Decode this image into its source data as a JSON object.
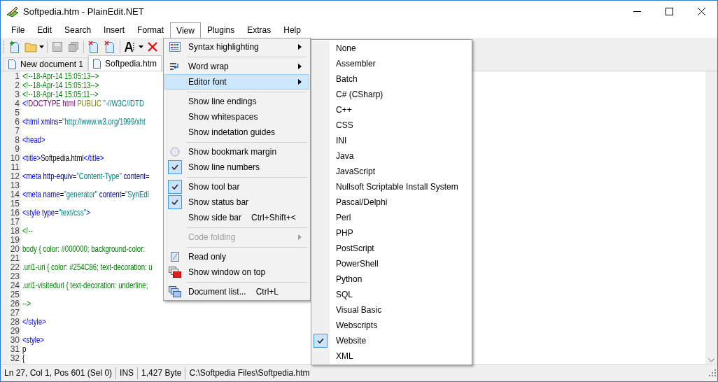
{
  "window": {
    "title": "Softpedia.htm - PlainEdit.NET"
  },
  "menu_bar": [
    {
      "label": "File",
      "selected": false
    },
    {
      "label": "Edit",
      "selected": false
    },
    {
      "label": "Search",
      "selected": false
    },
    {
      "label": "Insert",
      "selected": false
    },
    {
      "label": "Format",
      "selected": false
    },
    {
      "label": "View",
      "selected": true
    },
    {
      "label": "Plugins",
      "selected": false
    },
    {
      "label": "Extras",
      "selected": false
    },
    {
      "label": "Help",
      "selected": false
    }
  ],
  "tabs": [
    {
      "label": "New document 1",
      "selected": false
    },
    {
      "label": "Softpedia.htm",
      "selected": true
    }
  ],
  "editor": {
    "lines": [
      {
        "number": "1",
        "tokens": [
          {
            "kind": "comment",
            "text": "<!--18-Apr-14 15:05:13-->"
          }
        ]
      },
      {
        "number": "2",
        "tokens": [
          {
            "kind": "comment",
            "text": "<!--18-Apr-14 15:05:13-->"
          }
        ]
      },
      {
        "number": "3",
        "tokens": [
          {
            "kind": "comment",
            "text": "<!--18-Apr-14 15:05:11-->"
          }
        ]
      },
      {
        "number": "4",
        "tokens": [
          {
            "kind": "tag",
            "text": "<!"
          },
          {
            "kind": "doctype",
            "text": "DOCTYPE html "
          },
          {
            "kind": "keyword",
            "text": "PUBLIC "
          },
          {
            "kind": "value",
            "text": "\"-//W3C//DTD"
          }
        ]
      },
      {
        "number": "5"
      },
      {
        "number": "6",
        "tokens": [
          {
            "kind": "tag",
            "text": "<html"
          },
          {
            "kind": "attr",
            "text": " xmlns"
          },
          {
            "kind": "text",
            "text": "="
          },
          {
            "kind": "value",
            "text": "\"http://www.w3.org/1999/xht"
          }
        ]
      },
      {
        "number": "7"
      },
      {
        "number": "8",
        "tokens": [
          {
            "kind": "tag",
            "text": "<head>"
          }
        ]
      },
      {
        "number": "9"
      },
      {
        "number": "10",
        "tokens": [
          {
            "kind": "tag",
            "text": "<title>"
          },
          {
            "kind": "text",
            "text": "Softpedia.html"
          },
          {
            "kind": "tag",
            "text": "</title>"
          }
        ]
      },
      {
        "number": "11"
      },
      {
        "number": "12",
        "tokens": [
          {
            "kind": "tag",
            "text": "<meta"
          },
          {
            "kind": "attr",
            "text": " http-equiv"
          },
          {
            "kind": "text",
            "text": "="
          },
          {
            "kind": "value",
            "text": "\"Content-Type\""
          },
          {
            "kind": "attr",
            "text": " content"
          },
          {
            "kind": "text",
            "text": "="
          }
        ]
      },
      {
        "number": "13"
      },
      {
        "number": "14",
        "tokens": [
          {
            "kind": "tag",
            "text": "<meta"
          },
          {
            "kind": "attr",
            "text": " name"
          },
          {
            "kind": "text",
            "text": "="
          },
          {
            "kind": "value",
            "text": "\"generator\""
          },
          {
            "kind": "attr",
            "text": " content"
          },
          {
            "kind": "text",
            "text": "="
          },
          {
            "kind": "value",
            "text": "\"SynEdi"
          }
        ]
      },
      {
        "number": "15"
      },
      {
        "number": "16",
        "tokens": [
          {
            "kind": "tag",
            "text": "<style"
          },
          {
            "kind": "attr",
            "text": " type"
          },
          {
            "kind": "text",
            "text": "="
          },
          {
            "kind": "value",
            "text": "\"text/css\""
          },
          {
            "kind": "tag",
            "text": ">"
          }
        ]
      },
      {
        "number": "17"
      },
      {
        "number": "18",
        "tokens": [
          {
            "kind": "comment",
            "text": "<!--"
          }
        ]
      },
      {
        "number": "19"
      },
      {
        "number": "20",
        "tokens": [
          {
            "kind": "comment",
            "text": "body { color: #000000; background-color:"
          }
        ]
      },
      {
        "number": "21"
      },
      {
        "number": "22",
        "tokens": [
          {
            "kind": "comment",
            "text": ".uri1-uri { color: #254C86; text-decoration: u"
          }
        ]
      },
      {
        "number": "23"
      },
      {
        "number": "24",
        "tokens": [
          {
            "kind": "comment",
            "text": ".uri1-visiteduri { text-decoration: underline;"
          }
        ]
      },
      {
        "number": "25"
      },
      {
        "number": "26",
        "tokens": [
          {
            "kind": "comment",
            "text": "-->"
          }
        ]
      },
      {
        "number": "27"
      },
      {
        "number": "28",
        "tokens": [
          {
            "kind": "tag",
            "text": "</style>"
          }
        ]
      },
      {
        "number": "29"
      },
      {
        "number": "30",
        "tokens": [
          {
            "kind": "tag",
            "text": "<style>"
          }
        ]
      },
      {
        "number": "31",
        "tokens": [
          {
            "kind": "text",
            "text": "p"
          }
        ]
      },
      {
        "number": "32",
        "tokens": [
          {
            "kind": "text",
            "text": "{"
          }
        ]
      }
    ]
  },
  "view_menu": {
    "items": [
      {
        "kind": "item",
        "label": "Syntax highlighting",
        "submenu": true,
        "checked": false,
        "disabled": false,
        "selected": false
      },
      {
        "kind": "separator"
      },
      {
        "kind": "item",
        "label": "Word wrap",
        "submenu": true,
        "checked": false,
        "disabled": false,
        "selected": false
      },
      {
        "kind": "item",
        "label": "Editor font",
        "submenu": true,
        "checked": false,
        "disabled": false,
        "selected": true
      },
      {
        "kind": "separator"
      },
      {
        "kind": "item",
        "label": "Show line endings",
        "submenu": false,
        "checked": false,
        "disabled": false,
        "selected": false
      },
      {
        "kind": "item",
        "label": "Show whitespaces",
        "submenu": false,
        "checked": false,
        "disabled": false,
        "selected": false
      },
      {
        "kind": "item",
        "label": "Show indetation guides",
        "submenu": false,
        "checked": false,
        "disabled": false,
        "selected": false
      },
      {
        "kind": "separator"
      },
      {
        "kind": "item",
        "label": "Show bookmark margin",
        "submenu": false,
        "checked": false,
        "disabled": false,
        "selected": false
      },
      {
        "kind": "item",
        "label": "Show line numbers",
        "submenu": false,
        "checked": true,
        "disabled": false,
        "selected": false
      },
      {
        "kind": "separator"
      },
      {
        "kind": "item",
        "label": "Show tool bar",
        "submenu": false,
        "checked": true,
        "disabled": false,
        "selected": false
      },
      {
        "kind": "item",
        "label": "Show status bar",
        "submenu": false,
        "checked": true,
        "disabled": false,
        "selected": false
      },
      {
        "kind": "item",
        "label": "Show side bar",
        "shortcut": "Ctrl+Shift+<",
        "submenu": false,
        "checked": false,
        "disabled": false,
        "selected": false
      },
      {
        "kind": "separator"
      },
      {
        "kind": "item",
        "label": "Code folding",
        "submenu": true,
        "checked": false,
        "disabled": true,
        "selected": false
      },
      {
        "kind": "separator"
      },
      {
        "kind": "item",
        "label": "Read only",
        "submenu": false,
        "checked": false,
        "disabled": false,
        "selected": false
      },
      {
        "kind": "item",
        "label": "Show window on top",
        "submenu": false,
        "checked": false,
        "disabled": false,
        "selected": false
      },
      {
        "kind": "separator"
      },
      {
        "kind": "item",
        "label": "Document list...",
        "shortcut": "Ctrl+L",
        "submenu": false,
        "checked": false,
        "disabled": false,
        "selected": false
      }
    ]
  },
  "editor_font_menu": {
    "items": [
      {
        "label": "None",
        "checked": false
      },
      {
        "label": "Assembler",
        "checked": false
      },
      {
        "label": "Batch",
        "checked": false
      },
      {
        "label": "C# (CSharp)",
        "checked": false
      },
      {
        "label": "C++",
        "checked": false
      },
      {
        "label": "CSS",
        "checked": false
      },
      {
        "label": "INI",
        "checked": false
      },
      {
        "label": "Java",
        "checked": false
      },
      {
        "label": "JavaScript",
        "checked": false
      },
      {
        "label": "Nullsoft Scriptable Install System",
        "checked": false
      },
      {
        "label": "Pascal/Delphi",
        "checked": false
      },
      {
        "label": "Perl",
        "checked": false
      },
      {
        "label": "PHP",
        "checked": false
      },
      {
        "label": "PostScript",
        "checked": false
      },
      {
        "label": "PowerShell",
        "checked": false
      },
      {
        "label": "Python",
        "checked": false
      },
      {
        "label": "SQL",
        "checked": false
      },
      {
        "label": "Visual Basic",
        "checked": false
      },
      {
        "label": "Webscripts",
        "checked": false
      },
      {
        "label": "Website",
        "checked": true
      },
      {
        "label": "XML",
        "checked": false
      }
    ]
  },
  "status_bar": [
    "Ln 27, Col 1, Pos 601 (Sel 0)",
    "INS",
    "1,427 Byte",
    "C:\\Softpedia Files\\Softpedia.htm"
  ]
}
